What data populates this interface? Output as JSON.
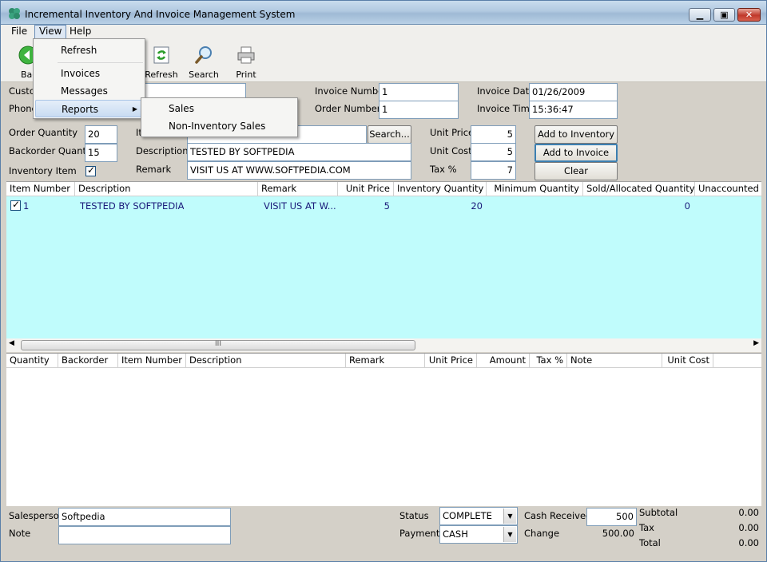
{
  "window": {
    "title": "Incremental Inventory And Invoice Management System"
  },
  "menubar": {
    "file": "File",
    "view": "View",
    "help": "Help"
  },
  "toolbar": {
    "back": "Bac",
    "refresh": "Refresh",
    "search": "Search",
    "print": "Print"
  },
  "view_menu": {
    "refresh": "Refresh",
    "invoices": "Invoices",
    "messages": "Messages",
    "reports": "Reports"
  },
  "reports_submenu": {
    "sales": "Sales",
    "non_inventory_sales": "Non-Inventory Sales"
  },
  "customer": {
    "customer_label": "Custo",
    "phone_label": "Phone"
  },
  "invoice": {
    "invoice_number_label": "Invoice Number",
    "invoice_number": "1",
    "order_number_label": "Order Number",
    "order_number": "1",
    "invoice_date_label": "Invoice Date",
    "invoice_date": "01/26/2009",
    "invoice_time_label": "Invoice Time",
    "invoice_time": "15:36:47"
  },
  "item": {
    "order_quantity_label": "Order Quantity",
    "order_quantity": "20",
    "backorder_quantity_label": "Backorder Quantity",
    "backorder_quantity": "15",
    "inventory_item_label": "Inventory Item",
    "item_label": "It",
    "description_label": "Description",
    "description": "TESTED BY SOFTPEDIA",
    "remark_label": "Remark",
    "remark": "VISIT US AT WWW.SOFTPEDIA.COM",
    "search_button": "Search...",
    "unit_price_label": "Unit Price",
    "unit_price": "5",
    "unit_cost_label": "Unit Cost",
    "unit_cost": "5",
    "tax_label": "Tax %",
    "tax": "7",
    "add_inventory_button": "Add to Inventory",
    "add_invoice_button": "Add to Invoice",
    "clear_button": "Clear"
  },
  "inventory_grid": {
    "columns": [
      "Item Number",
      "Description",
      "Remark",
      "Unit Price",
      "Inventory Quantity",
      "Minimum Quantity",
      "Sold/Allocated Quantity",
      "Unaccounted"
    ],
    "rows": [
      {
        "item_number": "1",
        "description": "TESTED BY SOFTPEDIA",
        "remark": "VISIT US AT W...",
        "unit_price": "5",
        "inventory_quantity": "20",
        "minimum_quantity": "",
        "sold_allocated": "0"
      }
    ]
  },
  "scrollbar": {
    "grip": "III"
  },
  "invoice_grid": {
    "columns": [
      "Quantity",
      "Backorder",
      "Item Number",
      "Description",
      "Remark",
      "Unit Price",
      "Amount",
      "Tax %",
      "Note",
      "Unit Cost"
    ]
  },
  "footer": {
    "salesperson_label": "Salesperson",
    "salesperson": "Softpedia",
    "note_label": "Note",
    "note": "",
    "status_label": "Status",
    "status": "COMPLETE",
    "payment_label": "Payment",
    "payment": "CASH",
    "cash_received_label": "Cash Received",
    "cash_received": "500",
    "change_label": "Change",
    "change": "500.00",
    "subtotal_label": "Subtotal",
    "subtotal": "0.00",
    "tax_label": "Tax",
    "tax": "0.00",
    "total_label": "Total",
    "total": "0.00"
  },
  "colors": {
    "inventory_grid_bg": "#c0fcfc",
    "grid_text": "#1a1a7a"
  }
}
